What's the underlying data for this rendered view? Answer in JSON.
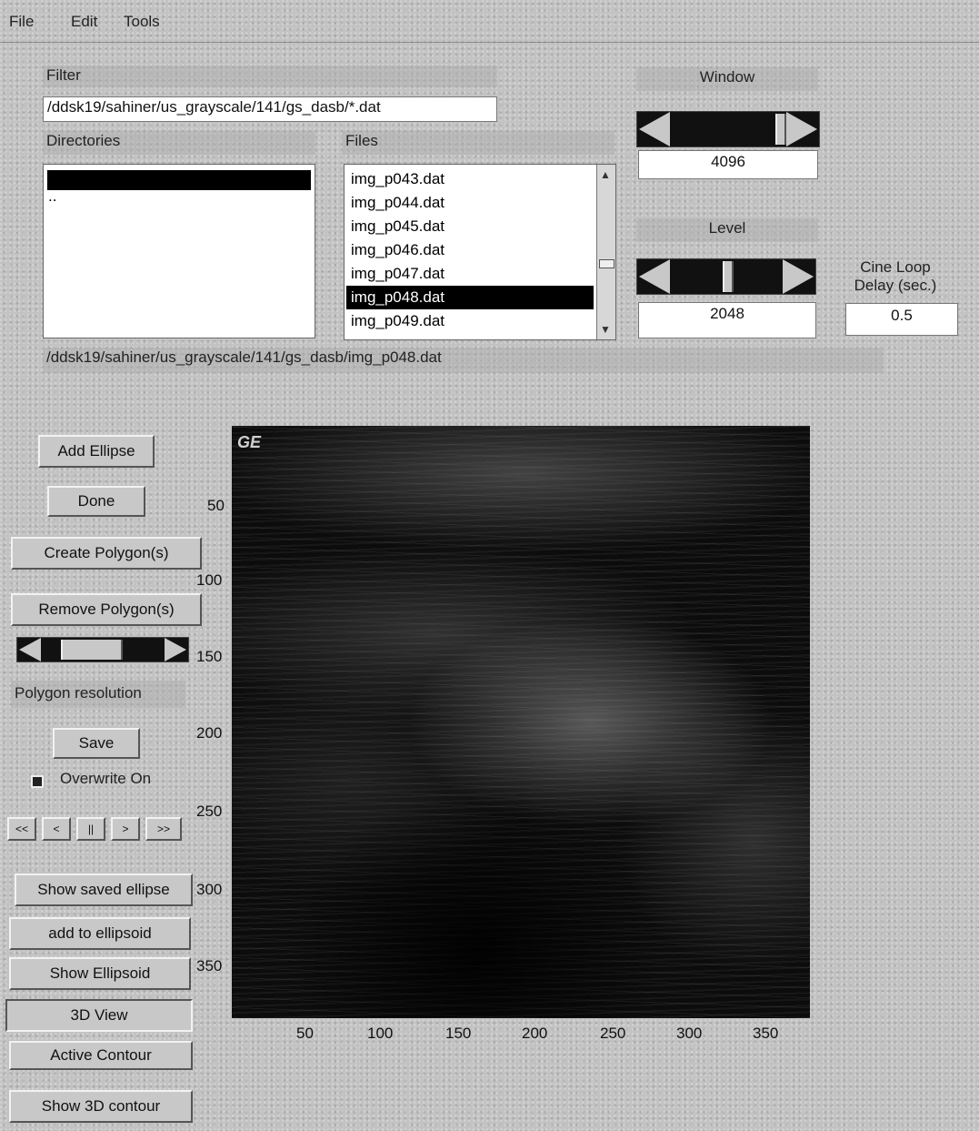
{
  "menu": [
    "File",
    "Edit",
    "Tools"
  ],
  "filter": {
    "label": "Filter",
    "value": "/ddsk19/sahiner/us_grayscale/141/gs_dasb/*.dat"
  },
  "directories": {
    "label": "Directories",
    "items": [
      "",
      ".."
    ]
  },
  "files": {
    "label": "Files",
    "items": [
      "img_p043.dat",
      "img_p044.dat",
      "img_p045.dat",
      "img_p046.dat",
      "img_p047.dat",
      "img_p048.dat",
      "img_p049.dat"
    ],
    "selected": "img_p048.dat"
  },
  "selection_path": "/ddsk19/sahiner/us_grayscale/141/gs_dasb/img_p048.dat",
  "window": {
    "label": "Window",
    "value": "4096"
  },
  "level": {
    "label": "Level",
    "value": "2048"
  },
  "cine": {
    "label_line1": "Cine Loop",
    "label_line2": "Delay (sec.)",
    "value": "0.5"
  },
  "buttons": {
    "add_ellipse": "Add Ellipse",
    "done": "Done",
    "create_polygons": "Create Polygon(s)",
    "remove_polygons": "Remove Polygon(s)",
    "polygon_resolution": "Polygon resolution",
    "save": "Save",
    "overwrite": "Overwrite On",
    "show_saved_ellipse": "Show saved ellipse",
    "add_to_ellipsoid": "add to ellipsoid",
    "show_ellipsoid": "Show Ellipsoid",
    "view_3d": "3D View",
    "active_contour": "Active Contour",
    "show_3d_contour": "Show 3D contour"
  },
  "playback": [
    "<<",
    "<",
    "||",
    ">",
    ">>"
  ],
  "image": {
    "brand": "GE",
    "y_ticks": [
      "50",
      "100",
      "150",
      "200",
      "250",
      "300",
      "350"
    ],
    "x_ticks": [
      "50",
      "100",
      "150",
      "200",
      "250",
      "300",
      "350"
    ]
  }
}
